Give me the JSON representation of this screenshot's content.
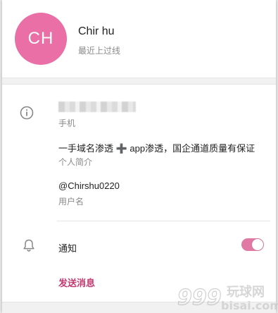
{
  "profile": {
    "avatar_initials": "CH",
    "avatar_color": "#e96fa6",
    "name": "Chir hu",
    "status": "最近上过线"
  },
  "info": {
    "phone_label": "手机",
    "bio": "一手域名渗透 ➕ app渗透，国企通道质量有保证",
    "bio_label": "个人简介",
    "username": "@Chirshu0220",
    "username_label": "用户名"
  },
  "notifications": {
    "label": "通知",
    "enabled": true,
    "toggle_color": "#e07aa5"
  },
  "actions": {
    "send_message": "发送消息",
    "send_color": "#c2396f"
  },
  "watermark": {
    "text_cn": "玩球网",
    "text_en": "bisai.com"
  }
}
